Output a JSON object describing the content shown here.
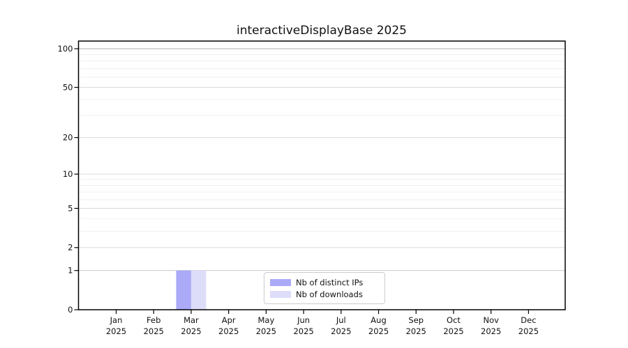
{
  "chart_data": {
    "type": "bar",
    "title": "interactiveDisplayBase 2025",
    "categories": [
      {
        "month": "Jan",
        "year": "2025"
      },
      {
        "month": "Feb",
        "year": "2025"
      },
      {
        "month": "Mar",
        "year": "2025"
      },
      {
        "month": "Apr",
        "year": "2025"
      },
      {
        "month": "May",
        "year": "2025"
      },
      {
        "month": "Jun",
        "year": "2025"
      },
      {
        "month": "Jul",
        "year": "2025"
      },
      {
        "month": "Aug",
        "year": "2025"
      },
      {
        "month": "Sep",
        "year": "2025"
      },
      {
        "month": "Oct",
        "year": "2025"
      },
      {
        "month": "Nov",
        "year": "2025"
      },
      {
        "month": "Dec",
        "year": "2025"
      }
    ],
    "series": [
      {
        "name": "Nb of distinct IPs",
        "color": "#aaaaf8",
        "values": [
          0,
          0,
          1,
          0,
          0,
          0,
          0,
          0,
          0,
          0,
          0,
          0
        ]
      },
      {
        "name": "Nb of downloads",
        "color": "#ddddfa",
        "values": [
          0,
          0,
          1,
          0,
          0,
          0,
          0,
          0,
          0,
          0,
          0,
          0
        ]
      }
    ],
    "xlabel": "",
    "ylabel": "",
    "yscale": "log1p",
    "ylim": [
      0,
      115
    ],
    "yticks": [
      0,
      1,
      2,
      5,
      10,
      20,
      50,
      100
    ],
    "yticks_minor": [
      3,
      4,
      6,
      7,
      8,
      9,
      30,
      40,
      60,
      70,
      80,
      90
    ],
    "grid": true,
    "legend_position": "lower center"
  },
  "legend": {
    "items": [
      {
        "label": "Nb of distinct IPs",
        "color": "#aaaaf8"
      },
      {
        "label": "Nb of downloads",
        "color": "#ddddfa"
      }
    ]
  },
  "style_colors": {
    "bar_distinct_ips": "#aaaaf8",
    "bar_downloads": "#ddddfa",
    "axis_spine": "#000000",
    "grid_major_top": "#b0b0b0",
    "grid_major_one": "#c8c8c8",
    "grid_major": "#dadada",
    "grid_minor": "#efefef"
  }
}
